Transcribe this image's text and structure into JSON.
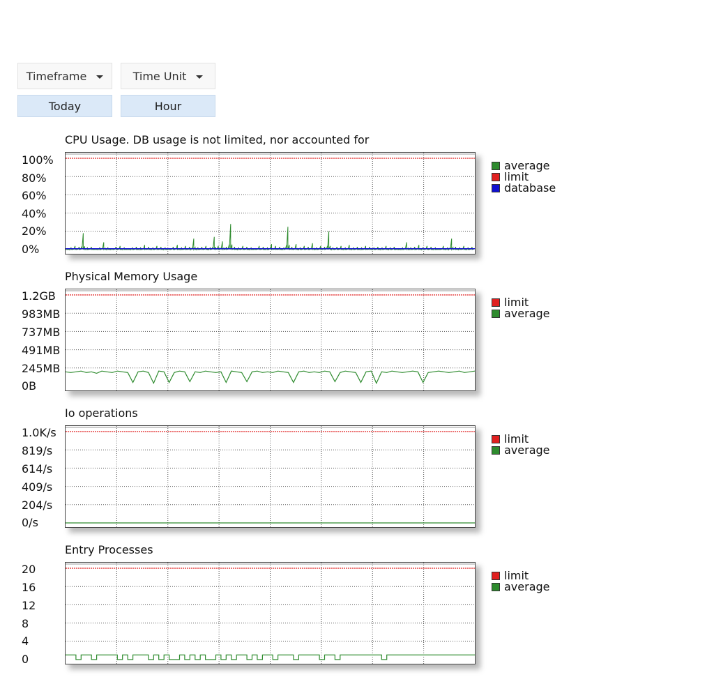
{
  "controls": {
    "timeframe_label": "Timeframe",
    "timeframe_value": "Today",
    "timeunit_label": "Time Unit",
    "timeunit_value": "Hour"
  },
  "colors": {
    "average": "#2e8b2e",
    "limit": "#e02020",
    "database": "#1010d0"
  },
  "charts": [
    {
      "title": "CPU Usage. DB usage is not limited, nor accounted for",
      "yticks": [
        "100%",
        "80%",
        "60%",
        "40%",
        "20%",
        "0%"
      ],
      "legend": [
        {
          "label": "average",
          "color": "#2e8b2e"
        },
        {
          "label": "limit",
          "color": "#e02020"
        },
        {
          "label": "database",
          "color": "#1010d0"
        }
      ]
    },
    {
      "title": "Physical Memory Usage",
      "yticks": [
        "1.2GB",
        "983MB",
        "737MB",
        "491MB",
        "245MB",
        "0B"
      ],
      "legend": [
        {
          "label": "limit",
          "color": "#e02020"
        },
        {
          "label": "average",
          "color": "#2e8b2e"
        }
      ]
    },
    {
      "title": "Io operations",
      "yticks": [
        "1.0K/s",
        "819/s",
        "614/s",
        "409/s",
        "204/s",
        "0/s"
      ],
      "legend": [
        {
          "label": "limit",
          "color": "#e02020"
        },
        {
          "label": "average",
          "color": "#2e8b2e"
        }
      ]
    },
    {
      "title": "Entry Processes",
      "yticks": [
        "20",
        "16",
        "12",
        "8",
        "4",
        "0"
      ],
      "legend": [
        {
          "label": "limit",
          "color": "#e02020"
        },
        {
          "label": "average",
          "color": "#2e8b2e"
        }
      ]
    }
  ],
  "chart_data": [
    {
      "type": "line",
      "title": "CPU Usage. DB usage is not limited, nor accounted for",
      "ylim": [
        0,
        100
      ],
      "series": [
        {
          "name": "average",
          "values": [
            1,
            2,
            4,
            3,
            18,
            2,
            3,
            1,
            2,
            8,
            2,
            1,
            3,
            4,
            2,
            1,
            2,
            3,
            2,
            5,
            3,
            2,
            4,
            3,
            2,
            1,
            3,
            5,
            2,
            4,
            3,
            12,
            2,
            3,
            4,
            2,
            14,
            4,
            9,
            3,
            28,
            3,
            2,
            4,
            3,
            2,
            1,
            4,
            3,
            2,
            6,
            4,
            3,
            2,
            25,
            3,
            6,
            2,
            4,
            3,
            7,
            2,
            4,
            3,
            20,
            2,
            3,
            4,
            2,
            5,
            2,
            3,
            2,
            4,
            3,
            2,
            3,
            2,
            4,
            2,
            3,
            1,
            2,
            8,
            2,
            3,
            5,
            2,
            4,
            3,
            2,
            1,
            4,
            2,
            12,
            3,
            2,
            4,
            2,
            3
          ]
        },
        {
          "name": "limit",
          "values": [
            100,
            100
          ]
        },
        {
          "name": "database",
          "values": [
            1,
            1
          ]
        }
      ]
    },
    {
      "type": "line",
      "title": "Physical Memory Usage",
      "ylim": [
        0,
        1.2
      ],
      "series": [
        {
          "name": "limit",
          "values": [
            1.2,
            1.2
          ]
        },
        {
          "name": "average",
          "values": [
            0.19,
            0.18,
            0.19,
            0.2,
            0.18,
            0.19,
            0.17,
            0.2,
            0.19,
            0.18,
            0.2,
            0.19,
            0.18,
            0.05,
            0.19,
            0.2,
            0.18,
            0.04,
            0.2,
            0.19,
            0.05,
            0.18,
            0.2,
            0.19,
            0.06,
            0.19,
            0.18,
            0.2,
            0.19,
            0.18,
            0.19,
            0.05,
            0.2,
            0.19,
            0.18,
            0.06,
            0.19,
            0.2,
            0.18,
            0.19,
            0.18,
            0.2,
            0.19,
            0.18,
            0.05,
            0.19,
            0.2,
            0.18,
            0.19,
            0.18,
            0.2,
            0.19,
            0.06,
            0.18,
            0.2,
            0.19,
            0.18,
            0.05,
            0.19,
            0.2,
            0.04,
            0.19,
            0.18,
            0.2,
            0.19,
            0.18,
            0.19,
            0.2,
            0.19,
            0.05,
            0.18,
            0.19,
            0.2,
            0.19,
            0.18,
            0.19,
            0.2,
            0.18,
            0.19,
            0.2
          ]
        }
      ]
    },
    {
      "type": "line",
      "title": "Io operations",
      "ylim": [
        0,
        1000
      ],
      "series": [
        {
          "name": "limit",
          "values": [
            1000,
            1000
          ]
        },
        {
          "name": "average",
          "values": [
            0,
            0
          ]
        }
      ]
    },
    {
      "type": "line",
      "title": "Entry Processes",
      "ylim": [
        0,
        20
      ],
      "series": [
        {
          "name": "limit",
          "values": [
            20,
            20
          ]
        },
        {
          "name": "average",
          "values": [
            1,
            1,
            0,
            1,
            1,
            0,
            1,
            1,
            1,
            1,
            0,
            1,
            0,
            1,
            1,
            1,
            0,
            1,
            0,
            1,
            0,
            0,
            1,
            0,
            1,
            0,
            1,
            0,
            0,
            1,
            0,
            1,
            0,
            1,
            1,
            0,
            1,
            0,
            1,
            1,
            0,
            1,
            1,
            1,
            0,
            1,
            1,
            1,
            1,
            0,
            1,
            1,
            0,
            1,
            1,
            1,
            1,
            1,
            1,
            1,
            1,
            0,
            1,
            1,
            1,
            1,
            1,
            1,
            1,
            1,
            1,
            1,
            1,
            1,
            1,
            1,
            1,
            1,
            1,
            1
          ]
        }
      ]
    }
  ]
}
